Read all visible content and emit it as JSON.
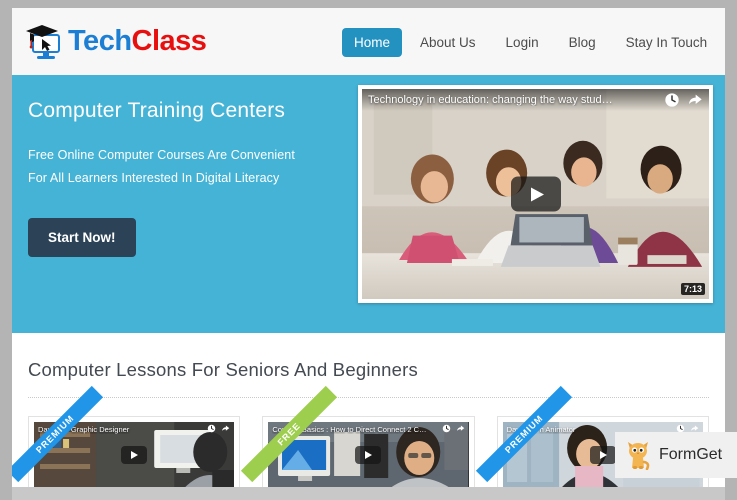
{
  "site": {
    "logo": {
      "text_part1": "Tech",
      "text_part2": "Class",
      "icon": "graduation-cap-monitor-cursor-icon",
      "color_blue": "#1d7fd4",
      "color_red": "#e8100f"
    },
    "nav": [
      {
        "label": "Home",
        "active": true
      },
      {
        "label": "About Us",
        "active": false
      },
      {
        "label": "Login",
        "active": false
      },
      {
        "label": "Blog",
        "active": false
      },
      {
        "label": "Stay In Touch",
        "active": false
      }
    ]
  },
  "hero": {
    "background_color": "#45b3d6",
    "title": "Computer Training Centers",
    "subtitle": "Free Online Computer Courses Are Convenient For All Learners Interested In Digital Literacy",
    "cta_label": "Start Now!",
    "cta_color": "#2b4257",
    "video": {
      "title": "Technology in education: changing the way stud…",
      "duration": "7:13",
      "clock_icon": "watch-later-clock-icon",
      "share_icon": "share-arrow-icon",
      "play_icon": "play-triangle-icon"
    }
  },
  "lessons": {
    "section_title": "Computer Lessons For Seniors And Beginners",
    "cards": [
      {
        "video_title": "Day in … Graphic Designer",
        "ribbon": "PREMIUM",
        "ribbon_color": "#2196e8",
        "clock_icon": "watch-later-clock-icon",
        "share_icon": "share-arrow-icon",
        "play_icon": "play-triangle-icon"
      },
      {
        "video_title": "Comp… Basics : How to Direct Connect 2 C…",
        "ribbon": "FREE",
        "ribbon_color": "#9ece4d",
        "clock_icon": "watch-later-clock-icon",
        "share_icon": "share-arrow-icon",
        "play_icon": "play-triangle-icon"
      },
      {
        "video_title": "Day in … h Animator",
        "ribbon": "PREMIUM",
        "ribbon_color": "#2196e8",
        "clock_icon": "watch-later-clock-icon",
        "share_icon": "share-arrow-icon",
        "play_icon": "play-triangle-icon"
      }
    ]
  },
  "watermark": {
    "label": "FormGet",
    "icon": "formget-cat-mascot-icon"
  }
}
